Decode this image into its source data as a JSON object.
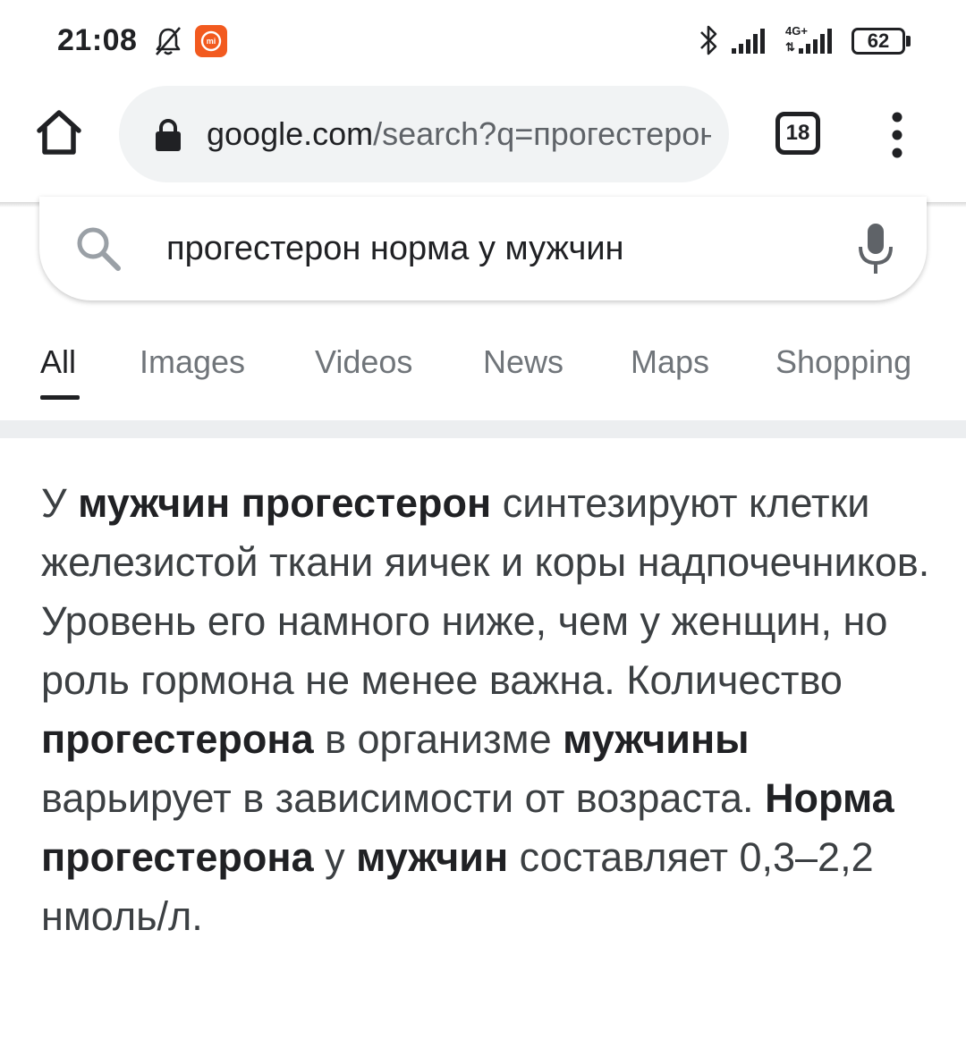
{
  "status_bar": {
    "time": "21:08",
    "network_label": "4G+",
    "network_arrows": "⇅",
    "battery": "62",
    "icons": [
      "bell-muted-icon",
      "mi-app-icon",
      "bluetooth-icon",
      "signal-icon",
      "signal-4g-icon",
      "battery-icon"
    ]
  },
  "browser": {
    "url_domain": "google.com",
    "url_path": "/search?q=прогестерон",
    "tab_count": "18",
    "icons": [
      "home-icon",
      "lock-icon",
      "tabs-icon",
      "more-vert-icon"
    ]
  },
  "search": {
    "query": "прогестерон норма у мужчин",
    "icons": [
      "search-icon",
      "mic-icon"
    ]
  },
  "tabs": [
    {
      "label": "All",
      "active": true
    },
    {
      "label": "Images",
      "active": false
    },
    {
      "label": "Videos",
      "active": false
    },
    {
      "label": "News",
      "active": false
    },
    {
      "label": "Maps",
      "active": false
    },
    {
      "label": "Shopping",
      "active": false
    }
  ],
  "snippet": {
    "segments": [
      {
        "text": "У ",
        "bold": false
      },
      {
        "text": "мужчин прогестерон",
        "bold": true
      },
      {
        "text": " синтезируют клетки железистой ткани яичек и коры надпочечников. Уровень его намного ниже, чем у женщин, но роль гормона не менее важна. Количество ",
        "bold": false
      },
      {
        "text": "прогестерона",
        "bold": true
      },
      {
        "text": " в организме ",
        "bold": false
      },
      {
        "text": "мужчины",
        "bold": true
      },
      {
        "text": " варьирует в зависимости от возраста. ",
        "bold": false
      },
      {
        "text": "Норма прогестерона",
        "bold": true
      },
      {
        "text": " у ",
        "bold": false
      },
      {
        "text": "мужчин",
        "bold": true
      },
      {
        "text": " составляет 0,3–2,2 нмоль/л.",
        "bold": false
      }
    ]
  },
  "colors": {
    "omnibox_bg": "#f1f3f4",
    "text_primary": "#202124",
    "text_secondary": "#70757a",
    "snippet_text": "#3c4043",
    "mi_badge": "#f25a1f"
  }
}
